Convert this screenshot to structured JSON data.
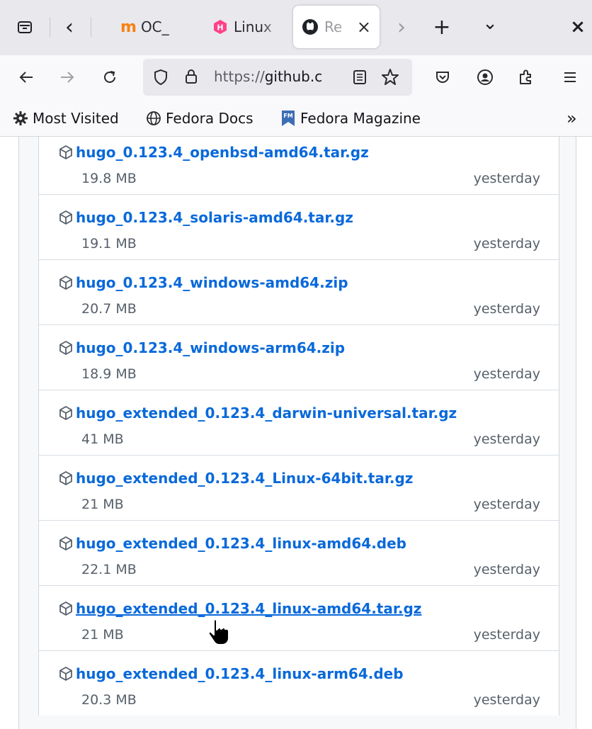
{
  "tabs": [
    {
      "label": "OC_",
      "icon": "moodle-icon",
      "color": "#f98012"
    },
    {
      "label": "Linux",
      "icon": "hugo-hex-icon",
      "color": "#ff4088"
    },
    {
      "label": "Re",
      "icon": "github-icon",
      "active": true,
      "close": "×"
    }
  ],
  "tabbar": {
    "overflow": "‹",
    "scroll_right": "›",
    "new_tab": "+",
    "list_all": "⌄",
    "close_window": "×"
  },
  "url": {
    "prefix": "https://",
    "host": "github.c"
  },
  "bookmarks": [
    {
      "label": "Most Visited",
      "icon": "gear-icon"
    },
    {
      "label": "Fedora Docs",
      "icon": "globe-icon"
    },
    {
      "label": "Fedora Magazine",
      "icon": "fedora-magazine-icon"
    }
  ],
  "bookmarks_overflow": "»",
  "assets": [
    {
      "name": "hugo_0.123.4_openbsd-amd64.tar.gz",
      "size": "19.8 MB",
      "date": "yesterday"
    },
    {
      "name": "hugo_0.123.4_solaris-amd64.tar.gz",
      "size": "19.1 MB",
      "date": "yesterday"
    },
    {
      "name": "hugo_0.123.4_windows-amd64.zip",
      "size": "20.7 MB",
      "date": "yesterday"
    },
    {
      "name": "hugo_0.123.4_windows-arm64.zip",
      "size": "18.9 MB",
      "date": "yesterday"
    },
    {
      "name": "hugo_extended_0.123.4_darwin-universal.tar.gz",
      "size": "41 MB",
      "date": "yesterday"
    },
    {
      "name": "hugo_extended_0.123.4_Linux-64bit.tar.gz",
      "size": "21 MB",
      "date": "yesterday"
    },
    {
      "name": "hugo_extended_0.123.4_linux-amd64.deb",
      "size": "22.1 MB",
      "date": "yesterday"
    },
    {
      "name": "hugo_extended_0.123.4_linux-amd64.tar.gz",
      "size": "21 MB",
      "date": "yesterday",
      "hover": true
    },
    {
      "name": "hugo_extended_0.123.4_linux-arm64.deb",
      "size": "20.3 MB",
      "date": "yesterday"
    }
  ]
}
